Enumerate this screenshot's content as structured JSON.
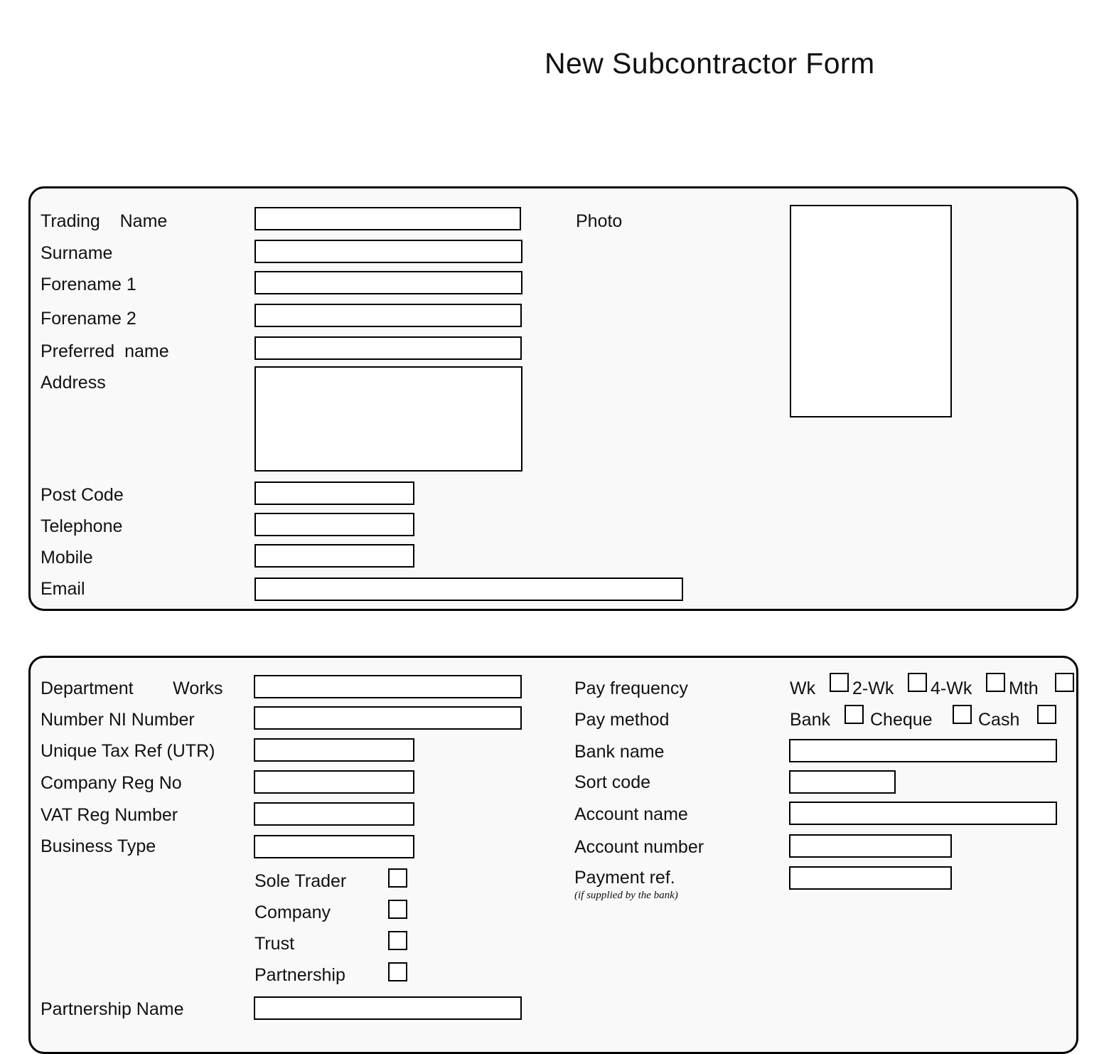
{
  "title": "New Subcontractor Form",
  "colors": {
    "page_background": "#ffffff",
    "panel_background": "#f9f9f9",
    "panel_border": "#000000",
    "field_background": "#ffffff",
    "field_border": "#000000",
    "text": "#111111"
  },
  "panels": {
    "personal": {
      "fields": [
        {
          "label": "Trading    Name",
          "value": "",
          "placeholder": ""
        },
        {
          "label": "Surname",
          "value": "",
          "placeholder": ""
        },
        {
          "label": "Forename 1",
          "value": "",
          "placeholder": ""
        },
        {
          "label": "Forename 2",
          "value": "",
          "placeholder": ""
        },
        {
          "label": "Preferred  name",
          "value": "",
          "placeholder": ""
        },
        {
          "label": "Address",
          "value": "",
          "placeholder": ""
        },
        {
          "label": "Post Code",
          "value": "",
          "placeholder": ""
        },
        {
          "label": "Telephone",
          "value": "",
          "placeholder": ""
        },
        {
          "label": "Mobile",
          "value": "",
          "placeholder": ""
        },
        {
          "label": "Email",
          "value": "",
          "placeholder": ""
        }
      ],
      "photo": {
        "label": "Photo",
        "value": ""
      }
    },
    "employment": {
      "left_fields": [
        {
          "label": "Department        Works",
          "value": "",
          "placeholder": ""
        },
        {
          "label": "Number NI Number",
          "value": "",
          "placeholder": ""
        },
        {
          "label": "Unique Tax Ref (UTR)",
          "value": "",
          "placeholder": ""
        },
        {
          "label": "Company Reg No",
          "value": "",
          "placeholder": ""
        },
        {
          "label": "VAT Reg Number",
          "value": "",
          "placeholder": ""
        },
        {
          "label": "Business Type",
          "value": "",
          "placeholder": ""
        },
        {
          "label": "Partnership Name",
          "value": "",
          "placeholder": ""
        }
      ],
      "business_types": [
        {
          "label": "Sole Trader",
          "checked": false
        },
        {
          "label": "Company",
          "checked": false
        },
        {
          "label": "Trust",
          "checked": false
        },
        {
          "label": "Partnership",
          "checked": false
        }
      ],
      "pay_frequency": {
        "label": "Pay frequency",
        "options": [
          {
            "label": "Wk",
            "checked": false
          },
          {
            "label": "2-Wk",
            "checked": false
          },
          {
            "label": "4-Wk",
            "checked": false
          },
          {
            "label": "Mth",
            "checked": false
          }
        ]
      },
      "pay_method": {
        "label": "Pay method",
        "options": [
          {
            "label": "Bank",
            "checked": false
          },
          {
            "label": "Cheque",
            "checked": false
          },
          {
            "label": "Cash",
            "checked": false
          }
        ]
      },
      "bank_fields": [
        {
          "label": "Bank name",
          "value": "",
          "placeholder": ""
        },
        {
          "label": "Sort code",
          "value": "",
          "placeholder": ""
        },
        {
          "label": "Account name",
          "value": "",
          "placeholder": ""
        },
        {
          "label": "Account number",
          "value": "",
          "placeholder": ""
        },
        {
          "label": "Payment ref.",
          "sublabel": "(if supplied by the bank)",
          "value": "",
          "placeholder": ""
        }
      ]
    }
  }
}
